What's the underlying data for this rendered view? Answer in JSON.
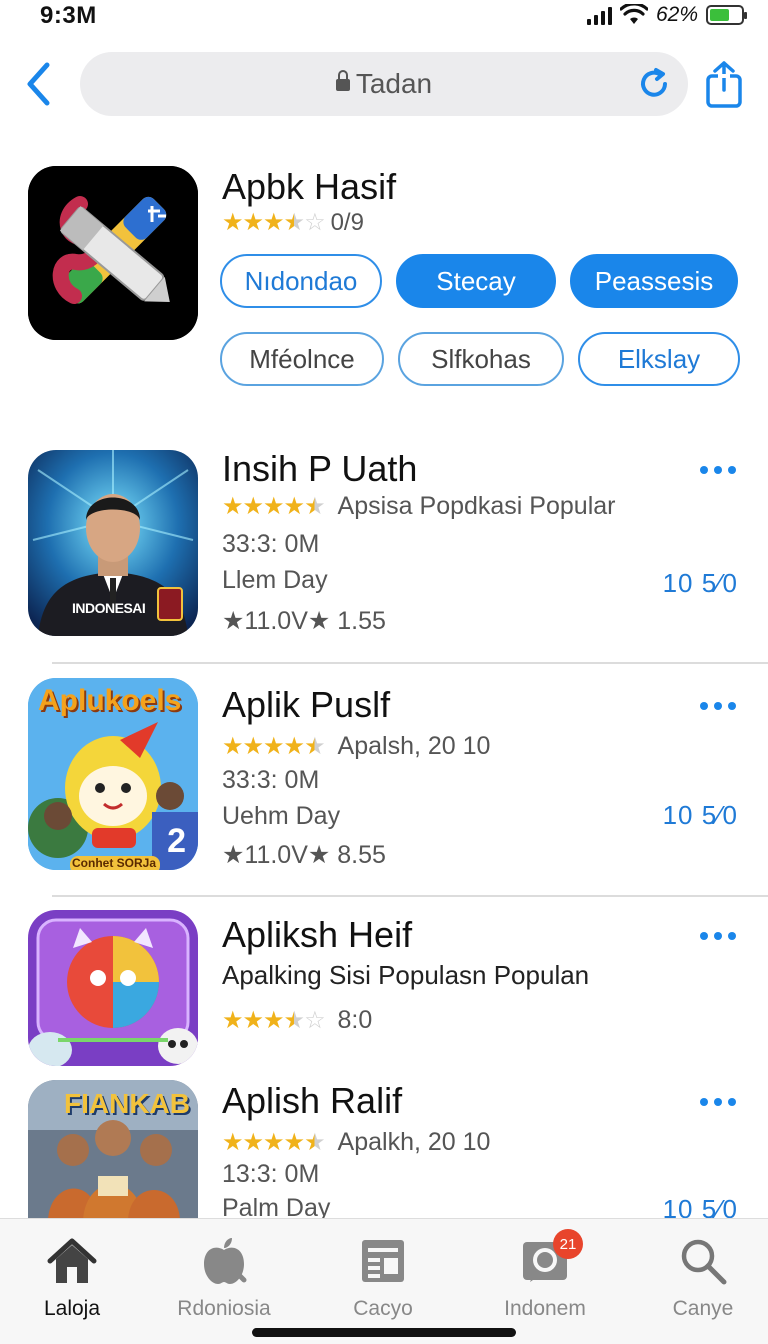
{
  "status_bar": {
    "time": "9:3M",
    "battery_text": "62%",
    "battery_level": 0.62
  },
  "nav": {
    "url_text": "Tadan",
    "icons": {
      "back": "chevron-left-icon",
      "lock": "lock-icon",
      "reload": "reload-icon",
      "share": "share-icon"
    }
  },
  "featured": {
    "title": "Apbk Hasif",
    "rating_value": "0/9",
    "stars": 3.5,
    "chips_row1": [
      {
        "label": "Nıdondao",
        "style": "outline"
      },
      {
        "label": "Stecay",
        "style": "filled"
      },
      {
        "label": "Peassesis",
        "style": "filled"
      }
    ],
    "chips_row2": [
      {
        "label": "Mféolnce",
        "style": "outline-gray"
      },
      {
        "label": "Slfkohas",
        "style": "outline-gray"
      },
      {
        "label": "Elkslay",
        "style": "outline"
      }
    ]
  },
  "apps": [
    {
      "title": "Insih P Uath",
      "stars": 4.5,
      "subtitle": "Apsisa Popdkasi Popular",
      "line1": "33:3: 0M",
      "line2": "Llem Day",
      "line3": "★11.0V★ 1.55",
      "meta": "10 5⁄0",
      "icon_badge": "INDONESAI"
    },
    {
      "title": "Aplik Puslf",
      "stars": 4.5,
      "subtitle": "Apalsh, 20 10",
      "line1": "33:3: 0M",
      "line2": "Uehm Day",
      "line3": "★11.0V★ 8.55",
      "meta": "10 5⁄0",
      "icon_title": "Aplukoels",
      "icon_badge": "Conhet SORJa",
      "icon_number": "2"
    },
    {
      "title": "Apliksh Heif",
      "subtitle": "Apalking Sisi Populasn Populan",
      "stars": 3.5,
      "rating_value": "8:0"
    },
    {
      "title": "Aplish Ralif",
      "stars": 4.5,
      "subtitle": "Apalkh, 20 10",
      "line1": "13:3: 0M",
      "line2": "Palm Day",
      "meta": "10 5⁄0",
      "icon_title": "FIANKAB"
    }
  ],
  "tabbar": {
    "tabs": [
      {
        "label": "Laloja",
        "icon": "home-icon",
        "active": true
      },
      {
        "label": "Rdoniosia",
        "icon": "apple-icon",
        "active": false
      },
      {
        "label": "Cacyo",
        "icon": "news-icon",
        "active": false
      },
      {
        "label": "Indonem",
        "icon": "chat-icon",
        "active": false,
        "badge": "21"
      },
      {
        "label": "Canye",
        "icon": "search-icon",
        "active": false
      }
    ]
  },
  "colors": {
    "accent": "#1a86ea",
    "star": "#f0b21a",
    "badge": "#e8452c"
  }
}
